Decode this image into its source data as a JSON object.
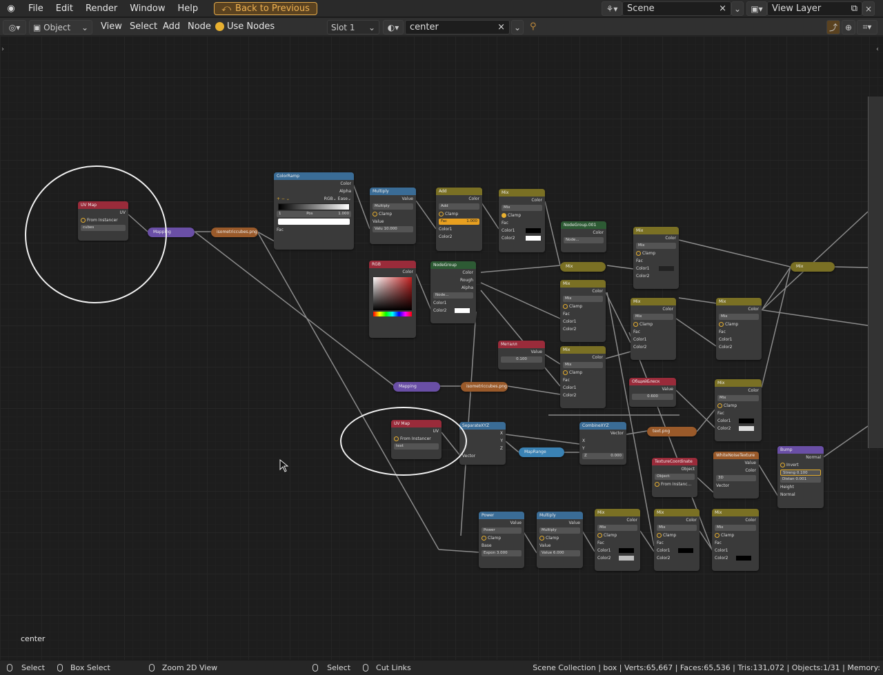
{
  "topbar": {
    "menu": [
      "File",
      "Edit",
      "Render",
      "Window",
      "Help"
    ],
    "back_button": "Back to Previous",
    "scene": "Scene",
    "view_layer": "View Layer"
  },
  "header": {
    "mode": "Object",
    "menus": [
      "View",
      "Select",
      "Add",
      "Node"
    ],
    "use_nodes": "Use Nodes",
    "slot": "Slot 1",
    "material": "center"
  },
  "canvas": {
    "label": "center"
  },
  "nodes": {
    "uvmap1": {
      "title": "UV Map",
      "out": "UV",
      "from_instancer": "From Instancer",
      "field": "cubes"
    },
    "uvmap2": {
      "title": "UV Map",
      "out": "UV",
      "from_instancer": "From Instancer",
      "field": "text"
    },
    "mapping1": "Mapping",
    "mapping2": "Mapping",
    "img1": "isometriccubes.png",
    "img2": "isometriccubes.png",
    "colorramp": {
      "title": "ColorRamp",
      "color": "Color",
      "alpha": "Alpha",
      "mode": "RGB",
      "interp": "Ease",
      "idx": "1",
      "pos": "Pos",
      "posval": "1.000",
      "fac": "Fac"
    },
    "multiply1": {
      "title": "Multiply",
      "value": "Value",
      "op": "Multiply",
      "clamp": "Clamp",
      "in": "Value",
      "field": "Valu  10.000"
    },
    "add": {
      "title": "Add",
      "color": "Color",
      "op": "Add",
      "clamp": "Clamp",
      "fac": "Fac",
      "facval": "1.000",
      "c1": "Color1",
      "c2": "Color2"
    },
    "mix_top": {
      "title": "Mix",
      "color": "Color",
      "op": "Mix",
      "clamp": "Clamp",
      "fac": "Fac",
      "c1": "Color1",
      "c2": "Color2"
    },
    "rgb": {
      "title": "RGB",
      "color": "Color"
    },
    "nodegroup": {
      "title": "NodeGroup",
      "color": "Color",
      "rough": "Rough",
      "alpha": "Alpha",
      "sel": "Node...",
      "c1": "Color1",
      "c2": "Color2"
    },
    "nodegroup001": {
      "title": "NodeGroup.001",
      "color": "Color",
      "sel": "Node..."
    },
    "mix_pill1": "Mix",
    "mix_pill2": "Mix",
    "metal": {
      "title": "Металл",
      "value": "Value",
      "field": "0.100"
    },
    "general_shine": {
      "title": "ОбщийБлеск",
      "value": "Value",
      "field": "0.600"
    },
    "separate": {
      "title": "SeparateXYZ",
      "x": "X",
      "y": "Y",
      "z": "Z",
      "vector": "Vector"
    },
    "maprange": "MapRange",
    "combine": {
      "title": "CombineXYZ",
      "vector": "Vector",
      "x": "X",
      "y": "Y",
      "z": "Z",
      "zval": "0.000"
    },
    "text_img": "text.png",
    "texcoord": {
      "title": "TextureCoordinate",
      "object": "Object",
      "objfield": "Object:",
      "from_instancer": "From Instanc...",
      "uv": "Vector"
    },
    "noise": {
      "title": "WhiteNoiseTexture",
      "value": "Value",
      "color": "Color",
      "dim": "3D",
      "vector": "Vector"
    },
    "bump": {
      "title": "Bump",
      "normal": "Normal",
      "invert": "Invert",
      "strength": "Streng  0.100",
      "distance": "Distan  0.001",
      "height": "Height",
      "normal_in": "Normal"
    },
    "power": {
      "title": "Power",
      "value": "Value",
      "op": "Power",
      "clamp": "Clamp",
      "base": "Base",
      "field": "Expon  3.000"
    },
    "multiply2": {
      "title": "Multiply",
      "value": "Value",
      "op": "Multiply",
      "clamp": "Clamp",
      "in": "Value",
      "field": "Value  6.000"
    }
  },
  "statusbar": {
    "select": "Select",
    "box_select": "Box Select",
    "zoom": "Zoom 2D View",
    "select2": "Select",
    "cut_links": "Cut Links",
    "stats": "Scene Collection | box | Verts:65,667 | Faces:65,536 | Tris:131,072 | Objects:1/31 | Memory:"
  }
}
